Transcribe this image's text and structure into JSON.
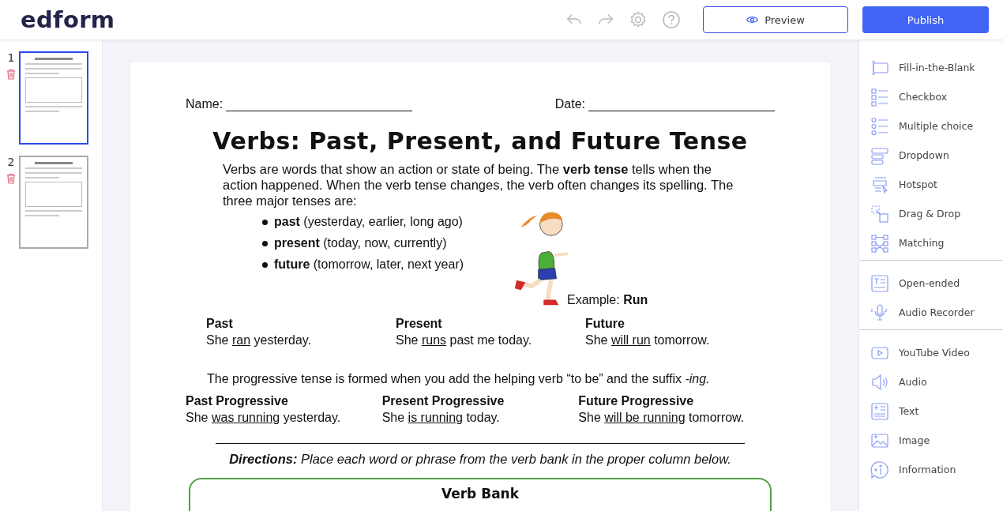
{
  "app": {
    "logo": "edform"
  },
  "toolbar": {
    "preview": "Preview",
    "publish": "Publish"
  },
  "pages": [
    {
      "number": "1",
      "selected": true
    },
    {
      "number": "2",
      "selected": false
    }
  ],
  "worksheet": {
    "name_label": "Name:",
    "date_label": "Date:",
    "title": "Verbs: Past, Present, and Future Tense",
    "intro": "Verbs are words that show an action or state of being. The **verb tense** tells when the action happened. When the verb tense changes, the verb often changes its spelling. The three major tenses are:",
    "tenses": [
      "**past** (yesterday, earlier, long ago)",
      "**present** (today, now, currently)",
      "**future** (tomorrow, later, next year)"
    ],
    "example": "Example: **Run**",
    "simple": [
      {
        "label": "Past",
        "before": "She ",
        "verb": "ran",
        "after": " yesterday."
      },
      {
        "label": "Present",
        "before": "She ",
        "verb": "runs",
        "after": " past me today."
      },
      {
        "label": "Future",
        "before": "She ",
        "verb": "will run",
        "after": " tomorrow."
      }
    ],
    "progressive_note": "The progressive tense is formed when you add the helping verb “to be” and the suffix *-ing.*",
    "progressive": [
      {
        "label": "Past Progressive",
        "before": "She ",
        "verb": "was running",
        "after": " yesterday."
      },
      {
        "label": "Present Progressive",
        "before": "She ",
        "verb": "is running",
        "after": " today."
      },
      {
        "label": "Future Progressive",
        "before": "She ",
        "verb": "will be running",
        "after": " tomorrow."
      }
    ],
    "directions": "**Directions:**  Place each word or phrase from the verb bank in the proper column below.",
    "verb_bank_title": "Verb Bank"
  },
  "tool_groups": [
    {
      "items": [
        {
          "label": "Fill-in-the-Blank",
          "kind": "blank"
        },
        {
          "label": "Checkbox",
          "kind": "checkbox"
        },
        {
          "label": "Multiple choice",
          "kind": "radio"
        },
        {
          "label": "Dropdown",
          "kind": "dropdown"
        },
        {
          "label": "Hotspot",
          "kind": "hotspot"
        },
        {
          "label": "Drag & Drop",
          "kind": "drag"
        },
        {
          "label": "Matching",
          "kind": "matching"
        }
      ]
    },
    {
      "items": [
        {
          "label": "Open-ended",
          "kind": "open"
        },
        {
          "label": "Audio Recorder",
          "kind": "mic"
        }
      ]
    },
    {
      "items": [
        {
          "label": "YouTube Video",
          "kind": "video"
        },
        {
          "label": "Audio",
          "kind": "audio"
        },
        {
          "label": "Text",
          "kind": "text"
        },
        {
          "label": "Image",
          "kind": "image"
        },
        {
          "label": "Information",
          "kind": "info"
        }
      ]
    }
  ]
}
